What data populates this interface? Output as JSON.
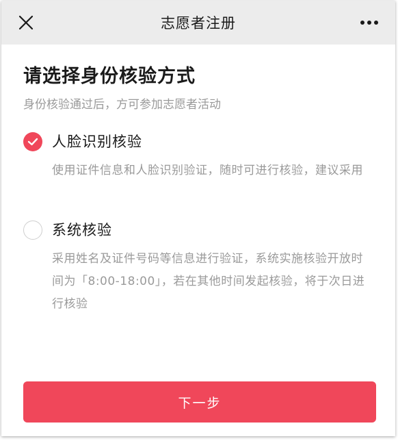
{
  "navbar": {
    "title": "志愿者注册",
    "close_icon": "close-icon",
    "more_icon": "more-icon"
  },
  "page": {
    "title": "请选择身份核验方式",
    "subtitle": "身份核验通过后，方可参加志愿者活动"
  },
  "options": [
    {
      "label": "人脸识别核验",
      "description": "使用证件信息和人脸识别验证，随时可进行核验，建议采用",
      "selected": true
    },
    {
      "label": "系统核验",
      "description": "采用姓名及证件号码等信息进行验证，系统实施核验开放时间为「8:00-18:00」，若在其他时间发起核验，将于次日进行核验",
      "selected": false
    }
  ],
  "footer": {
    "next_label": "下一步"
  },
  "colors": {
    "accent": "#f0475a",
    "navbar_bg": "#ececec",
    "muted_text": "#9a9a9a",
    "primary_text": "#1a1a1a"
  }
}
